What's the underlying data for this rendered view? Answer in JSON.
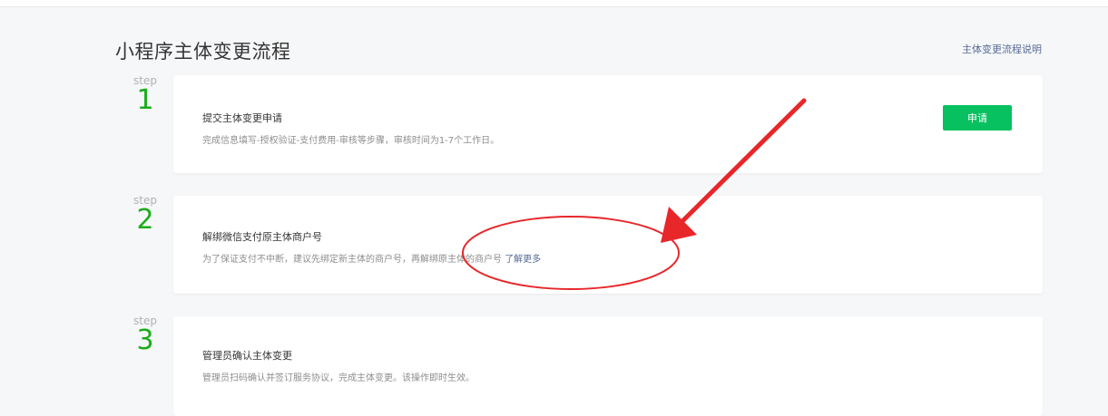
{
  "header": {
    "title": "小程序主体变更流程",
    "help_link": "主体变更流程说明"
  },
  "steps": [
    {
      "step_label": "step",
      "number": "1",
      "title": "提交主体变更申请",
      "description": "完成信息填写-授权验证-支付费用-审核等步骤，审核时间为1-7个工作日。",
      "button_label": "申请"
    },
    {
      "step_label": "step",
      "number": "2",
      "title": "解绑微信支付原主体商户号",
      "description": "为了保证支付不中断，建议先绑定新主体的商户号，再解绑原主体的商户号",
      "link_label": "了解更多"
    },
    {
      "step_label": "step",
      "number": "3",
      "title": "管理员确认主体变更",
      "description": "管理员扫码确认并签订服务协议，完成主体变更。该操作即时生效。"
    }
  ],
  "colors": {
    "accent_green": "#07c160",
    "step_number_green": "#1aad19",
    "link_blue": "#576b95",
    "annotation_red": "#e8272a"
  }
}
